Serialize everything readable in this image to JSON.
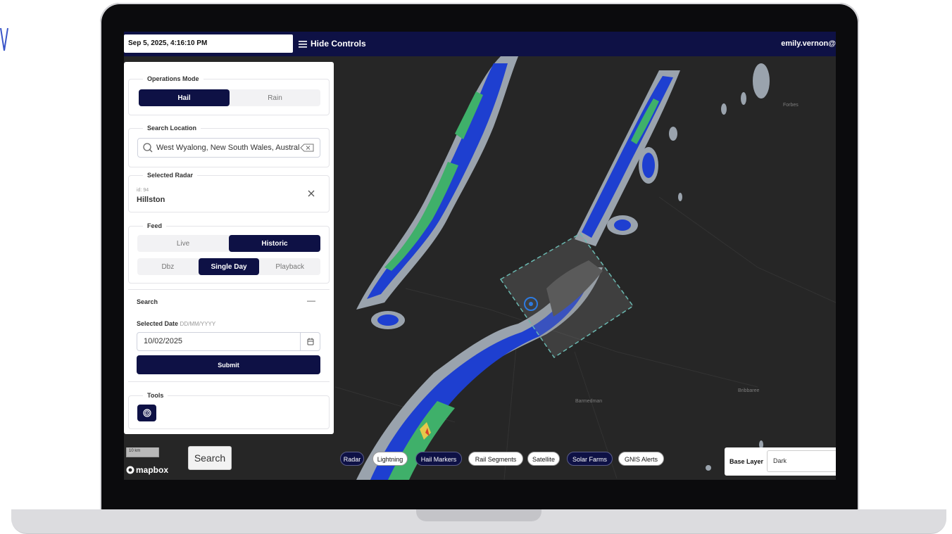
{
  "topbar": {
    "datetime": "Sep 5, 2025, 4:16:10 PM",
    "hide_controls_label": "Hide Controls",
    "user": "emily.vernon@"
  },
  "operations_mode": {
    "title": "Operations Mode",
    "options": [
      "Hail",
      "Rain"
    ],
    "selected": "Hail"
  },
  "search_location": {
    "title": "Search Location",
    "value": "West Wyalong, New South Wales, Australia"
  },
  "selected_radar": {
    "title": "Selected Radar",
    "id_text": "id: 94",
    "name": "Hillston"
  },
  "feed": {
    "title": "Feed",
    "source_options": [
      "Live",
      "Historic"
    ],
    "source_selected": "Historic",
    "mode_options": [
      "Dbz",
      "Single Day",
      "Playback"
    ],
    "mode_selected": "Single Day"
  },
  "search": {
    "title": "Search",
    "date_label": "Selected Date",
    "date_format": "DD/MM/YYYY",
    "date_value": "10/02/2025",
    "submit_label": "Submit"
  },
  "tools": {
    "title": "Tools"
  },
  "map": {
    "scale_label": "10 km",
    "attribution": "mapbox",
    "search_button": "Search",
    "places": [
      "Forbes",
      "Barmedman",
      "Bribbaree"
    ],
    "layers": [
      {
        "label": "Radar",
        "active": true
      },
      {
        "label": "Lightning",
        "active": false
      },
      {
        "label": "Hail Markers",
        "active": true
      },
      {
        "label": "Rail Segments",
        "active": false
      },
      {
        "label": "Satellite",
        "active": false
      },
      {
        "label": "Solar Farms",
        "active": true
      },
      {
        "label": "GNIS Alerts",
        "active": false
      }
    ],
    "base_layer_label": "Base Layer",
    "base_layer_value": "Dark"
  },
  "colors": {
    "navy": "#0e1145",
    "radar_blue": "#1e3fd0",
    "radar_green": "#3fb06a",
    "radar_grey": "#9aa3ad",
    "zone_outline": "#6ab8b0"
  }
}
